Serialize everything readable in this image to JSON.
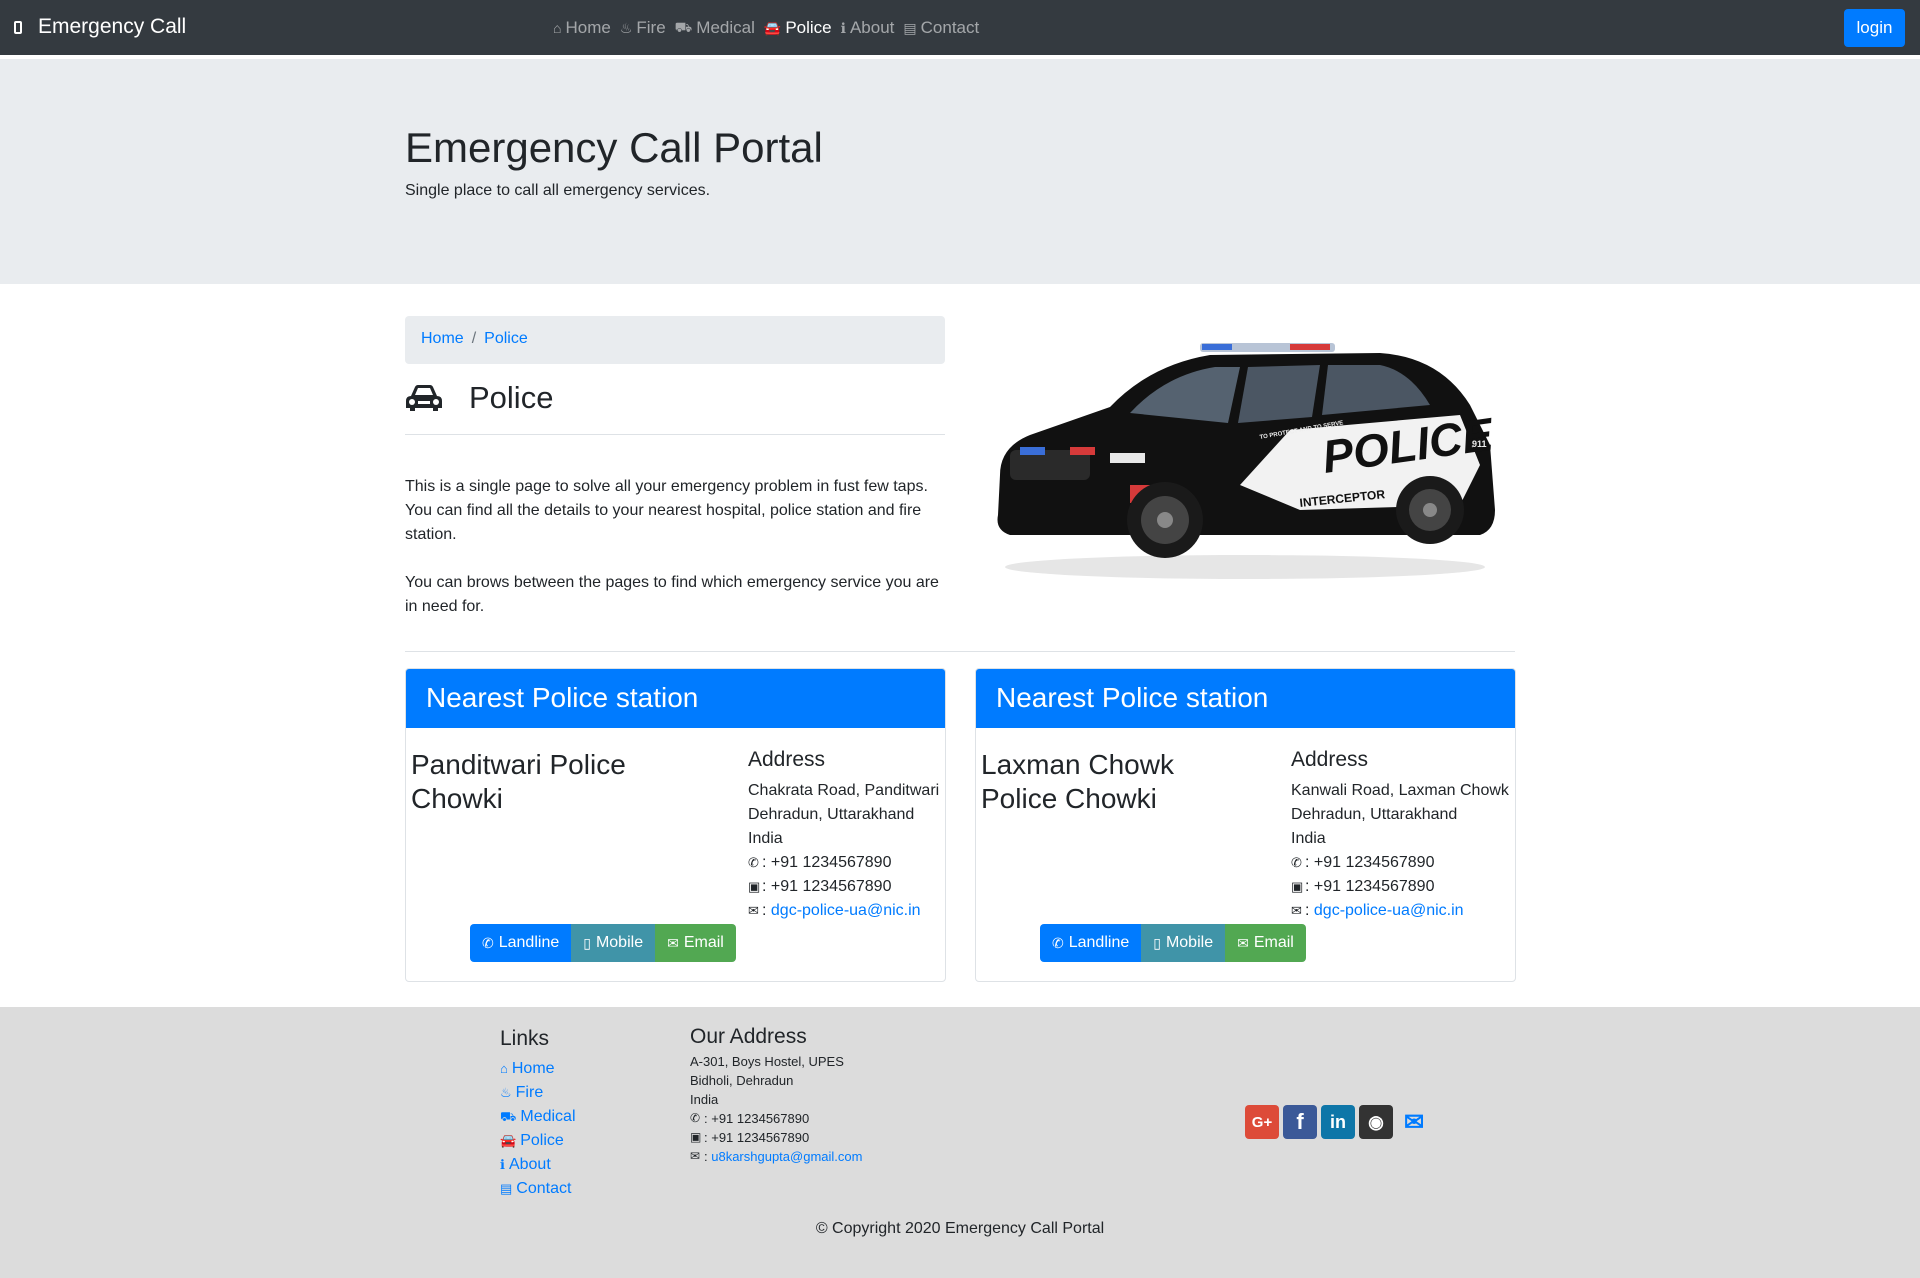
{
  "navbar": {
    "brand": "Emergency Call",
    "links": [
      {
        "icon": "home-icon",
        "glyph": "⌂",
        "label": "Home"
      },
      {
        "icon": "fire-icon",
        "glyph": "♨",
        "label": "Fire"
      },
      {
        "icon": "ambulance-icon",
        "glyph": "⛟",
        "label": "Medical"
      },
      {
        "icon": "car-icon",
        "glyph": "🚘",
        "label": "Police"
      },
      {
        "icon": "info-icon",
        "glyph": "ℹ",
        "label": "About"
      },
      {
        "icon": "address-card-icon",
        "glyph": "▤",
        "label": "Contact"
      }
    ],
    "active": "Police",
    "login": "login"
  },
  "jumbotron": {
    "title": "Emergency Call Portal",
    "subtitle": "Single place to call all emergency services."
  },
  "breadcrumb": [
    "Home",
    "Police"
  ],
  "page": {
    "title": "Police",
    "paragraphs": [
      "This is a single page to solve all your emergency problem in fust few taps. You can find all the details to your nearest hospital, police station and fire station.",
      "You can brows between the pages to find which emergency service you are in need for."
    ],
    "image_text": {
      "main": "POLICE",
      "sub": "INTERCEPTOR",
      "door": "TO PROTECT AND TO SERVE",
      "badge": "911"
    }
  },
  "cards": [
    {
      "header": "Nearest Police station",
      "name": "Panditwari Police Chowki",
      "address_title": "Address",
      "address": [
        "Chakrata Road, Panditwari",
        "Dehradun, Uttarakhand",
        "India"
      ],
      "landline": "+91 1234567890",
      "fax": "+91 1234567890",
      "email": "dgc-police-ua@nic.in",
      "buttons": {
        "landline": "Landline",
        "mobile": "Mobile",
        "email": "Email"
      }
    },
    {
      "header": "Nearest Police station",
      "name": "Laxman Chowk Police Chowki",
      "address_title": "Address",
      "address": [
        "Kanwali Road, Laxman Chowk",
        "Dehradun, Uttarakhand",
        "India"
      ],
      "landline": "+91 1234567890",
      "fax": "+91 1234567890",
      "email": "dgc-police-ua@nic.in",
      "buttons": {
        "landline": "Landline",
        "mobile": "Mobile",
        "email": "Email"
      }
    }
  ],
  "footer": {
    "links_title": "Links",
    "links": [
      "Home",
      "Fire",
      "Medical",
      "Police",
      "About",
      "Contact"
    ],
    "address_title": "Our Address",
    "address": [
      "A-301, Boys Hostel, UPES",
      "Bidholi, Dehradun",
      "India"
    ],
    "phone": "+91 1234567890",
    "fax": "+91 1234567890",
    "email": "u8karshgupta@gmail.com",
    "social": [
      "google-plus-icon",
      "facebook-icon",
      "linkedin-icon",
      "github-icon",
      "envelope-icon"
    ],
    "copyright": "© Copyright 2020 Emergency Call Portal"
  },
  "colors": {
    "navbar": "#343a40",
    "primary": "#007bff",
    "jumbotron": "#e9ecef",
    "footer": "#dcdcdc",
    "mobile_btn": "#4094a8",
    "email_btn": "#52a852"
  }
}
